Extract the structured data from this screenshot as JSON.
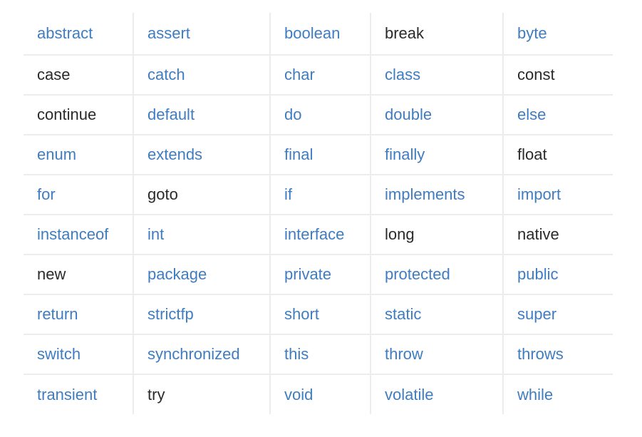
{
  "colors": {
    "link": "#3f7dc0",
    "plain": "#2a2a2a",
    "grid": "#ececec"
  },
  "rows": [
    [
      {
        "text": "abstract",
        "link": true
      },
      {
        "text": "assert",
        "link": true
      },
      {
        "text": "boolean",
        "link": true
      },
      {
        "text": "break",
        "link": false
      },
      {
        "text": "byte",
        "link": true
      }
    ],
    [
      {
        "text": "case",
        "link": false
      },
      {
        "text": "catch",
        "link": true
      },
      {
        "text": "char",
        "link": true
      },
      {
        "text": "class",
        "link": true
      },
      {
        "text": "const",
        "link": false
      }
    ],
    [
      {
        "text": "continue",
        "link": false
      },
      {
        "text": "default",
        "link": true
      },
      {
        "text": "do",
        "link": true
      },
      {
        "text": "double",
        "link": true
      },
      {
        "text": "else",
        "link": true
      }
    ],
    [
      {
        "text": "enum",
        "link": true
      },
      {
        "text": "extends",
        "link": true
      },
      {
        "text": "final",
        "link": true
      },
      {
        "text": "finally",
        "link": true
      },
      {
        "text": "float",
        "link": false
      }
    ],
    [
      {
        "text": "for",
        "link": true
      },
      {
        "text": "goto",
        "link": false
      },
      {
        "text": "if",
        "link": true
      },
      {
        "text": "implements",
        "link": true
      },
      {
        "text": "import",
        "link": true
      }
    ],
    [
      {
        "text": "instanceof",
        "link": true
      },
      {
        "text": "int",
        "link": true
      },
      {
        "text": "interface",
        "link": true
      },
      {
        "text": "long",
        "link": false
      },
      {
        "text": "native",
        "link": false
      }
    ],
    [
      {
        "text": "new",
        "link": false
      },
      {
        "text": "package",
        "link": true
      },
      {
        "text": "private",
        "link": true
      },
      {
        "text": "protected",
        "link": true
      },
      {
        "text": "public",
        "link": true
      }
    ],
    [
      {
        "text": "return",
        "link": true
      },
      {
        "text": "strictfp",
        "link": true
      },
      {
        "text": "short",
        "link": true
      },
      {
        "text": "static",
        "link": true
      },
      {
        "text": "super",
        "link": true
      }
    ],
    [
      {
        "text": "switch",
        "link": true
      },
      {
        "text": "synchronized",
        "link": true
      },
      {
        "text": "this",
        "link": true
      },
      {
        "text": "throw",
        "link": true
      },
      {
        "text": "throws",
        "link": true
      }
    ],
    [
      {
        "text": "transient",
        "link": true
      },
      {
        "text": "try",
        "link": false
      },
      {
        "text": "void",
        "link": true
      },
      {
        "text": "volatile",
        "link": true
      },
      {
        "text": "while",
        "link": true
      }
    ]
  ]
}
